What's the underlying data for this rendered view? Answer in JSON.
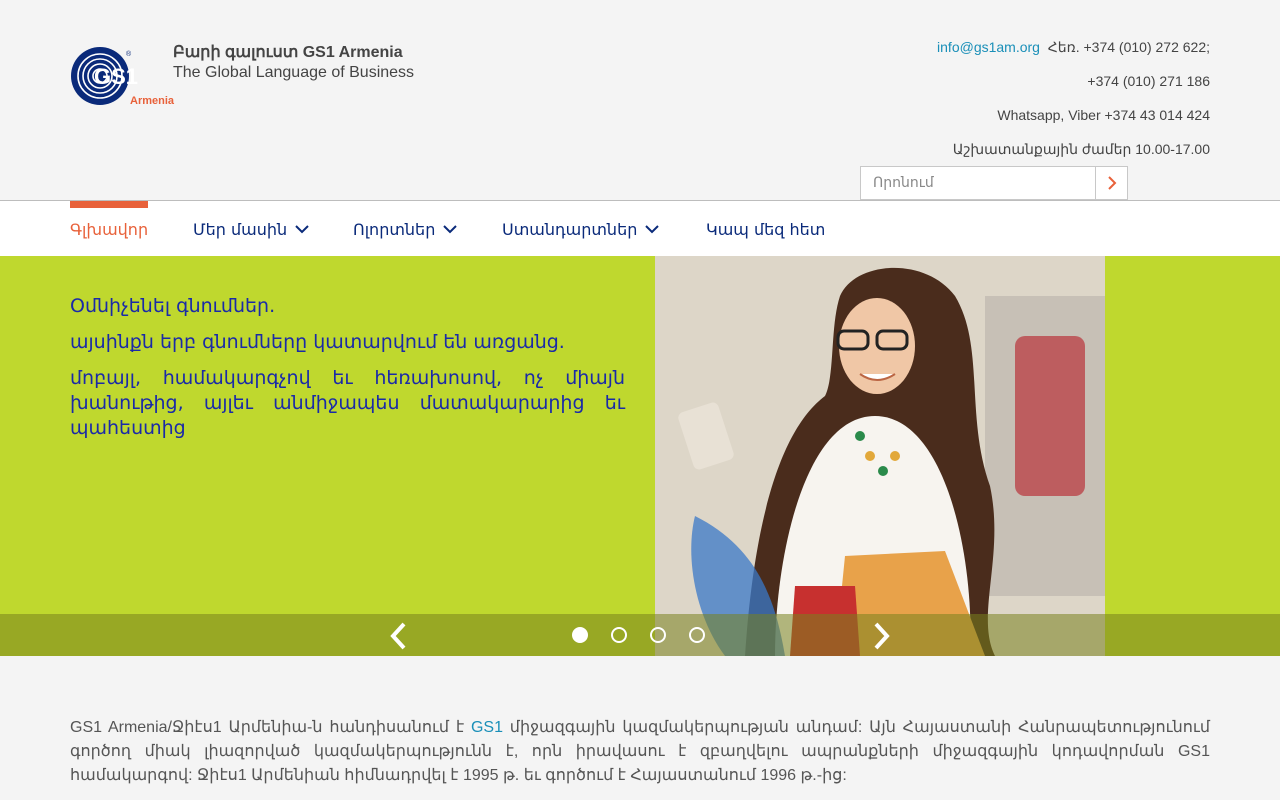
{
  "header": {
    "logo_text": "GS1",
    "logo_sub": "Armenia",
    "title": "Բարի գալուստ GS1 Armenia",
    "subtitle": "The Global Language of Business"
  },
  "contacts": {
    "email": "info@gs1am.org",
    "phone1": "Հեռ. +374 (010) 272 622;",
    "phone2": "+374 (010) 271 186",
    "messengers": "Whatsapp, Viber +374 43 014 424",
    "hours": "Աշխատանքային ժամեր 10.00-17.00"
  },
  "search": {
    "placeholder": "Որոնում"
  },
  "nav": {
    "items": [
      {
        "label": "Գլխավոր"
      },
      {
        "label": "Մեր մասին"
      },
      {
        "label": "Ոլորտներ"
      },
      {
        "label": "Ստանդարտներ"
      },
      {
        "label": "Կապ մեզ հետ"
      }
    ]
  },
  "hero": {
    "line1": "Օմնիչենել գնումներ.",
    "line2": "այսինքն երբ գնումները կատարվում են առցանց.",
    "line3": "մոբայլ, համակարգչով եւ հեռախոսով, ոչ միայն խանութից, այլեւ անմիջապես մատակարարից եւ պահեստից",
    "slide_count": 4,
    "active_slide": 1
  },
  "intro": {
    "before": "GS1 Armenia/Ջիէս1 Արմենիա-ն հանդիսանում է ",
    "link": "GS1",
    "after": "  միջազգային կազմակերպության անդամ: Այն Հայաստանի Հանրապետությունում գործող միակ լիազորված կազմակերպությունն է, որն իրավասու է զբաղվելու ապրանքների միջազգային կոդավորման GS1 համակարգով: Ջիէս1 Արմենիան հիմնադրվել է 1995 թ. եւ գործում է Հայաստանում 1996 թ.-ից:"
  },
  "colors": {
    "accent": "#e8613a",
    "nav_text": "#0a2a7a",
    "hero_bg": "#bfd82e",
    "hero_text": "#1a2aa8",
    "link": "#1a8fb8"
  }
}
